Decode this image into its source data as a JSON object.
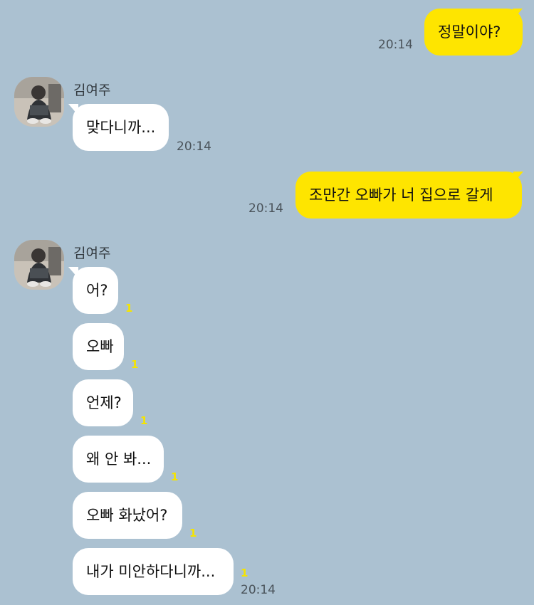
{
  "colors": {
    "background": "#abc1d1",
    "my_bubble": "#fee500",
    "their_bubble": "#ffffff",
    "unread_count": "#f5e400"
  },
  "messages": [
    {
      "side": "me",
      "text": "정말이야?",
      "time": "20:14"
    },
    {
      "side": "them",
      "sender": "김여주",
      "text": "맞다니까...",
      "time": "20:14"
    },
    {
      "side": "me",
      "text": "조만간 오빠가 너 집으로 갈게",
      "time": "20:14"
    },
    {
      "side": "them",
      "sender": "김여주",
      "text": "어?",
      "unread": "1"
    },
    {
      "side": "them",
      "text": "오빠",
      "unread": "1"
    },
    {
      "side": "them",
      "text": "언제?",
      "unread": "1"
    },
    {
      "side": "them",
      "text": "왜 안 봐...",
      "unread": "1"
    },
    {
      "side": "them",
      "text": "오빠 화났어?",
      "unread": "1"
    },
    {
      "side": "them",
      "text": "내가 미안하다니까...",
      "unread": "1",
      "time": "20:14"
    }
  ],
  "avatar": {
    "icon": "profile-photo-avatar"
  }
}
